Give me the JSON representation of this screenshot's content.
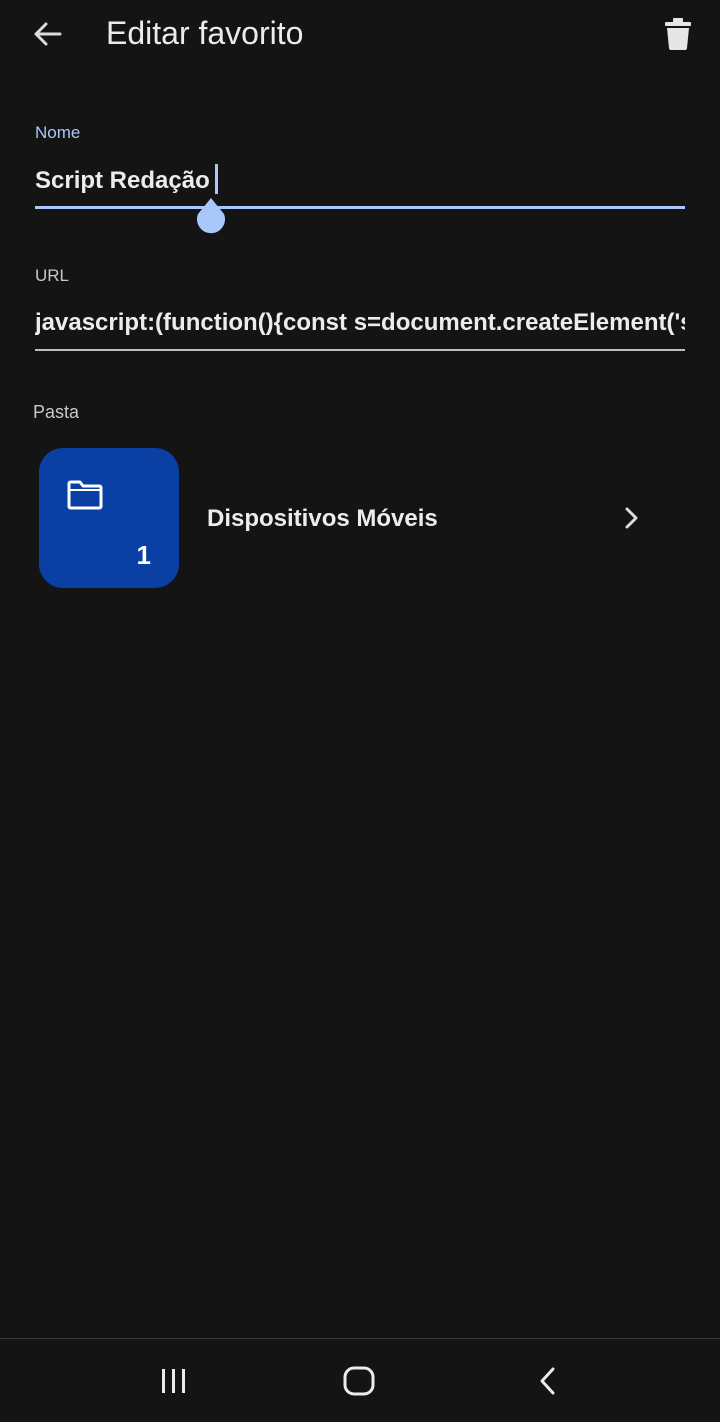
{
  "app_bar": {
    "title": "Editar favorito",
    "back_icon": "arrow-left-icon",
    "delete_icon": "trash-icon"
  },
  "form": {
    "name_label": "Nome",
    "name_value": "Script Redação",
    "url_label": "URL",
    "url_value": "javascript:(function(){const s=document.createElement('script')",
    "folder_label": "Pasta"
  },
  "folder": {
    "name": "Dispositivos Móveis",
    "count": "1",
    "icon": "folder-icon",
    "chevron_icon": "chevron-right-icon"
  },
  "navigation": {
    "recent_icon": "recent-apps-icon",
    "home_icon": "home-icon",
    "back_icon": "back-icon"
  },
  "colors": {
    "background": "#141414",
    "accent": "#a8c7fa",
    "folder_tile": "#0a3fa3",
    "text": "#ececec"
  }
}
